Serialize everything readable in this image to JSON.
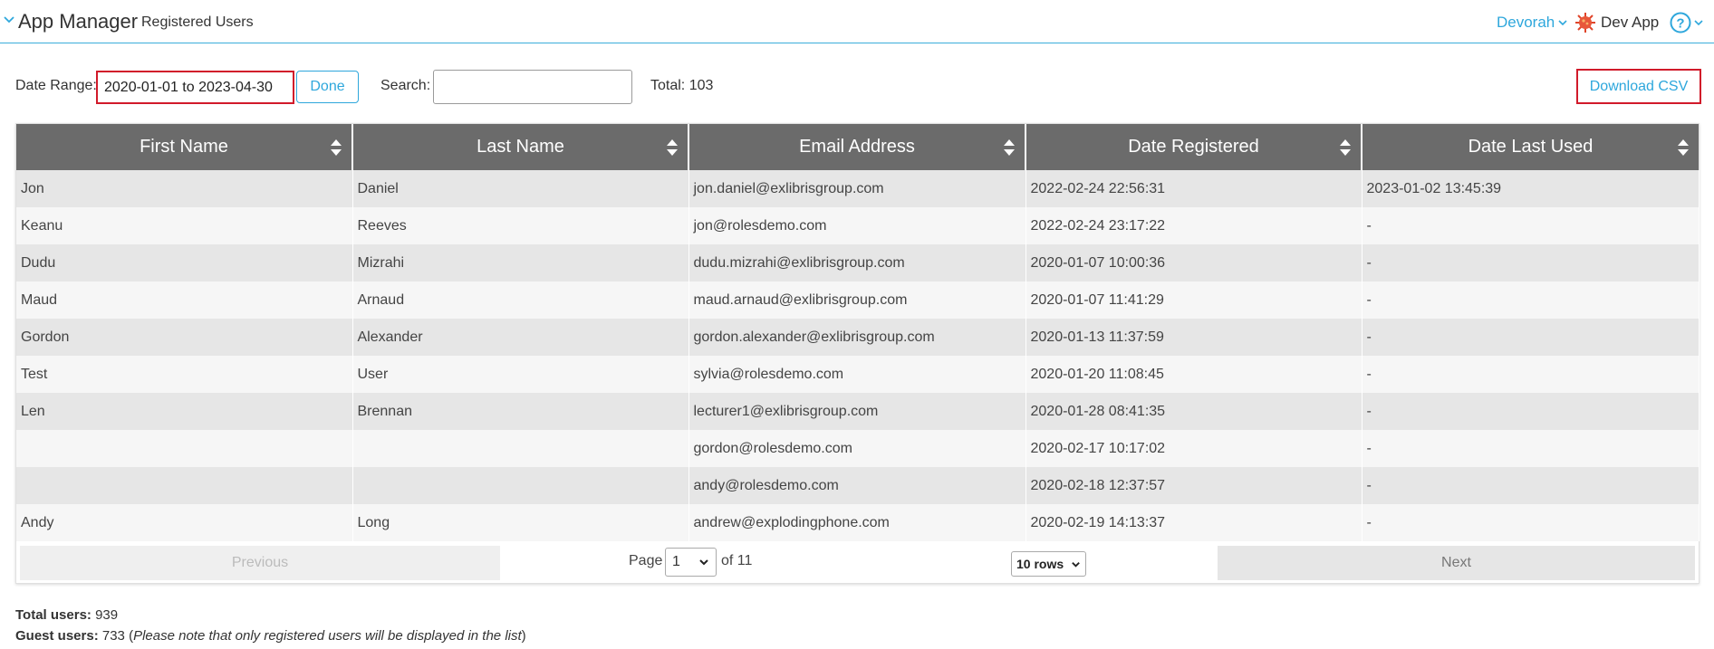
{
  "header": {
    "app_title": "App Manager",
    "page_subtitle": "Registered Users",
    "user_name": "Devorah",
    "app_name": "Dev App",
    "accent_color": "#2ea7dc"
  },
  "toolbar": {
    "date_range_label": "Date Range:",
    "date_range_value": "2020-01-01 to 2023-04-30",
    "done_label": "Done",
    "search_label": "Search:",
    "search_value": "",
    "total_text": "Total: 103",
    "download_csv_label": "Download CSV"
  },
  "table": {
    "columns": [
      "First Name",
      "Last Name",
      "Email Address",
      "Date Registered",
      "Date Last Used"
    ],
    "rows": [
      [
        "Jon",
        "Daniel",
        "jon.daniel@exlibrisgroup.com",
        "2022-02-24 22:56:31",
        "2023-01-02 13:45:39"
      ],
      [
        "Keanu",
        "Reeves",
        "jon@rolesdemo.com",
        "2022-02-24 23:17:22",
        "-"
      ],
      [
        "Dudu",
        "Mizrahi",
        "dudu.mizrahi@exlibrisgroup.com",
        "2020-01-07 10:00:36",
        "-"
      ],
      [
        "Maud",
        "Arnaud",
        "maud.arnaud@exlibrisgroup.com",
        "2020-01-07 11:41:29",
        "-"
      ],
      [
        "Gordon",
        "Alexander",
        "gordon.alexander@exlibrisgroup.com",
        "2020-01-13 11:37:59",
        "-"
      ],
      [
        "Test",
        "User",
        "sylvia@rolesdemo.com",
        "2020-01-20 11:08:45",
        "-"
      ],
      [
        "Len",
        "Brennan",
        "lecturer1@exlibrisgroup.com",
        "2020-01-28 08:41:35",
        "-"
      ],
      [
        "",
        "",
        "gordon@rolesdemo.com",
        "2020-02-17 10:17:02",
        "-"
      ],
      [
        "",
        "",
        "andy@rolesdemo.com",
        "2020-02-18 12:37:57",
        "-"
      ],
      [
        "Andy",
        "Long",
        "andrew@explodingphone.com",
        "2020-02-19 14:13:37",
        "-"
      ]
    ]
  },
  "pagination": {
    "previous_label": "Previous",
    "next_label": "Next",
    "page_label": "Page",
    "current_page": "1",
    "of_text": "of 11",
    "rows_per_page": "10 rows"
  },
  "summary": {
    "total_users_label": "Total users:",
    "total_users_value": "939",
    "guest_users_label": "Guest users:",
    "guest_users_value": "733",
    "guest_note": "Please note that only registered users will be displayed in the list"
  }
}
